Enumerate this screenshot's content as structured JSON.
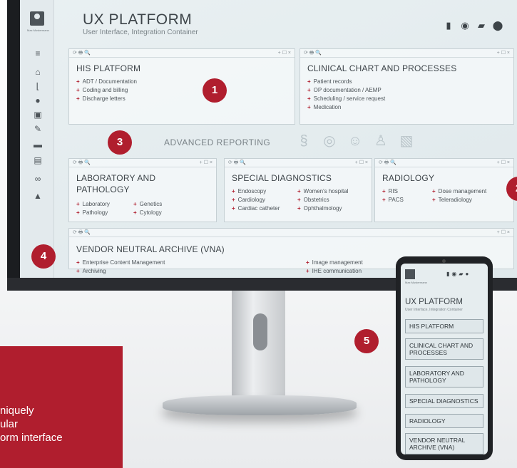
{
  "header": {
    "title": "UX PLATFORM",
    "subtitle": "User Interface, Integration Container",
    "icons": [
      "document-icon",
      "radiation-icon",
      "chat-icon",
      "nx-icon"
    ]
  },
  "sidebar": {
    "user_label": "Max Mustermann",
    "icons": [
      "menu-icon",
      "home-icon",
      "chart-icon",
      "pills-icon",
      "lab-icon",
      "pen-icon",
      "bed-icon",
      "files-icon",
      "binoculars-icon",
      "flask-icon"
    ]
  },
  "panels": {
    "his": {
      "title": "HIS PLATFORM",
      "items": [
        "ADT / Documentation",
        "Coding and billing",
        "Discharge letters"
      ]
    },
    "clinical": {
      "title": "CLINICAL CHART AND PROCESSES",
      "items": [
        "Patient records",
        "OP documentation / AEMP",
        "Scheduling / service request",
        "Medication"
      ]
    },
    "lab": {
      "title_line1": "LABORATORY AND",
      "title_line2": "PATHOLOGY",
      "col1": [
        "Laboratory",
        "Pathology"
      ],
      "col2": [
        "Genetics",
        "Cytology"
      ]
    },
    "special": {
      "title": "SPECIAL DIAGNOSTICS",
      "col1": [
        "Endoscopy",
        "Cardiology",
        "Cardiac catheter"
      ],
      "col2": [
        "Women's hospital",
        "Obstetrics",
        "Ophthalmology"
      ]
    },
    "radiology": {
      "title": "RADIOLOGY",
      "col1": [
        "RIS",
        "PACS"
      ],
      "col2": [
        "Dose management",
        "Teleradiology"
      ]
    },
    "vna": {
      "title": "VENDOR NEUTRAL ARCHIVE (VNA)",
      "col1": [
        "Enterprise Content Management",
        "Archiving"
      ],
      "col2": [
        "Image management",
        "IHE communication"
      ]
    }
  },
  "advanced_reporting": "ADVANCED REPORTING",
  "badges": [
    "1",
    "2",
    "3",
    "4",
    "5"
  ],
  "redbox_text": [
    "niquely",
    "ular",
    "orm interface"
  ],
  "phone": {
    "title": "UX PLATFORM",
    "subtitle": "User Interface, Integration Container",
    "user_label": "Max Mustermann",
    "buttons": [
      "HIS PLATFORM",
      "CLINICAL CHART AND PROCESSES",
      "LABORATORY AND PATHOLOGY",
      "SPECIAL DIAGNOSTICS",
      "RADIOLOGY",
      "VENDOR NEUTRAL ARCHIVE (VNA)"
    ]
  },
  "panel_toolbar": {
    "left": "⟳ 🖶 🔍",
    "right": "+ ☐ ×"
  }
}
